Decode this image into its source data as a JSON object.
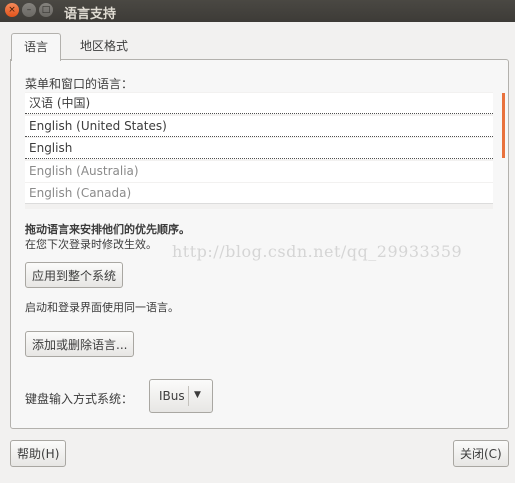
{
  "window": {
    "title": "语言支持",
    "controls": {
      "close_glyph": "×",
      "minimize_glyph": "–",
      "maximize_glyph": "□"
    }
  },
  "tabs": [
    {
      "label": "语言",
      "active": true
    },
    {
      "label": "地区格式",
      "active": false
    }
  ],
  "language_panel": {
    "list_label": "菜单和窗口的语言：",
    "languages": [
      {
        "label": "汉语 (中国)",
        "enabled": true
      },
      {
        "label": "English (United States)",
        "enabled": true
      },
      {
        "label": "English",
        "enabled": true
      },
      {
        "label": "English (Australia)",
        "enabled": false
      },
      {
        "label": "English (Canada)",
        "enabled": false
      }
    ],
    "drag_hint": "拖动语言来安排他们的优先顺序。",
    "drag_subhint": "在您下次登录时修改生效。",
    "apply_button": "应用到整个系统",
    "login_note": "启动和登录界面使用同一语言。",
    "add_remove_button": "添加或删除语言...",
    "keyboard_label": "键盘输入方式系统：",
    "keyboard_value": "IBus"
  },
  "footer": {
    "help_button": "帮助(H)",
    "close_button": "关闭(C)"
  },
  "watermark": "http://blog.csdn.net/qq_29933359",
  "colors": {
    "accent": "#e9723d",
    "titlebar": "#3d3b37"
  },
  "icons": {
    "dropdown": "chevron-down-icon",
    "close": "close-icon"
  }
}
